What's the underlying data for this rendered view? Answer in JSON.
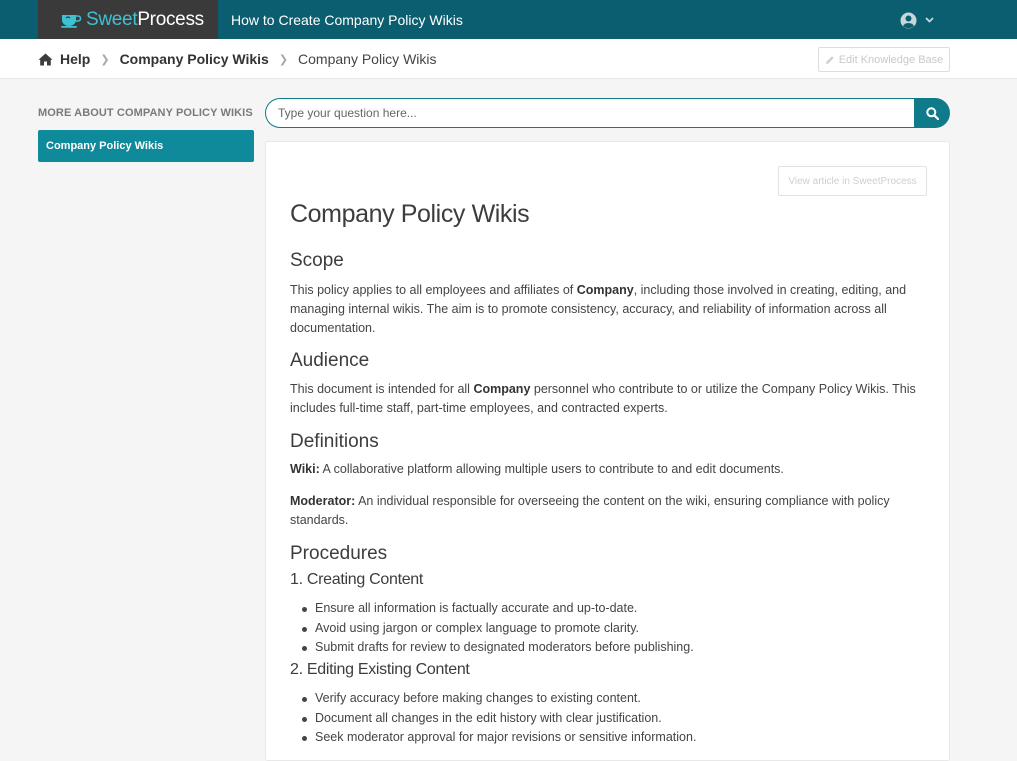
{
  "brand": {
    "sweet": "Sweet",
    "process": "Process"
  },
  "header": {
    "title": "How to Create Company Policy Wikis"
  },
  "breadcrumb": {
    "home": "Help",
    "section": "Company Policy Wikis",
    "current": "Company Policy Wikis",
    "edit_button": "Edit Knowledge Base"
  },
  "sidebar": {
    "heading": "MORE ABOUT COMPANY POLICY WIKIS",
    "items": [
      {
        "label": "Company Policy Wikis",
        "active": true
      }
    ]
  },
  "search": {
    "placeholder": "Type your question here...",
    "value": ""
  },
  "article": {
    "view_button": "View article in SweetProcess",
    "title": "Company Policy Wikis",
    "scope": {
      "heading": "Scope",
      "text_before": "This policy applies to all employees and affiliates of ",
      "bold": "Company",
      "text_after": ", including those involved in creating, editing, and managing internal wikis. The aim is to promote consistency, accuracy, and reliability of information across all documentation."
    },
    "audience": {
      "heading": "Audience",
      "text_before": "This document is intended for all ",
      "bold": "Company",
      "text_after": " personnel who contribute to or utilize the Company Policy Wikis. This includes full-time staff, part-time employees, and contracted experts."
    },
    "definitions": {
      "heading": "Definitions",
      "items": [
        {
          "term": "Wiki:",
          "text": " A collaborative platform allowing multiple users to contribute to and edit documents."
        },
        {
          "term": "Moderator:",
          "text": " An individual responsible for overseeing the content on the wiki, ensuring compliance with policy standards."
        }
      ]
    },
    "procedures": {
      "heading": "Procedures",
      "sections": [
        {
          "title": "1. Creating Content",
          "items": [
            "Ensure all information is factually accurate and up-to-date.",
            "Avoid using jargon or complex language to promote clarity.",
            "Submit drafts for review to designated moderators before publishing."
          ]
        },
        {
          "title": "2. Editing Existing Content",
          "items": [
            "Verify accuracy before making changes to existing content.",
            "Document all changes in the edit history with clear justification.",
            "Seek moderator approval for major revisions or sensitive information."
          ]
        }
      ]
    }
  },
  "colors": {
    "topbar": "#0b5e6f",
    "logo_bg": "#3a3a3a",
    "accent": "#0e8a9a",
    "brand_sweet": "#3fc1d4"
  },
  "icons": {
    "logo": "teacup-icon",
    "user": "user-circle-icon",
    "dropdown": "chevron-down-icon",
    "home": "home-icon",
    "separator": "chevron-right-icon",
    "edit": "pencil-icon",
    "search": "search-icon"
  }
}
